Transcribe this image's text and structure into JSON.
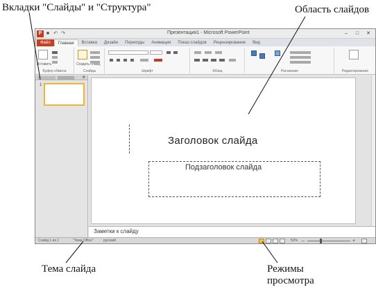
{
  "annotations": {
    "tabs_callout": "Вкладки \"Слайды\" и \"Структура\"",
    "slide_area_callout": "Область слайдов",
    "theme_callout": "Тема слайда",
    "view_modes_callout_line1": "Режимы",
    "view_modes_callout_line2": "просмотра"
  },
  "window": {
    "title": "Презентация1 - Microsoft PowerPoint",
    "app_icon_letter": "P"
  },
  "ribbon": {
    "file_tab": "Файл",
    "tabs": [
      "Главная",
      "Вставка",
      "Дизайн",
      "Переходы",
      "Анимация",
      "Показ слайдов",
      "Рецензирование",
      "Вид"
    ],
    "groups": [
      "Буфер обмена",
      "Слайды",
      "Шрифт",
      "Абзац",
      "Рисование",
      "Редактирование"
    ],
    "paste_label": "Вставить",
    "new_slide_label": "Создать слайд"
  },
  "slides_pane": {
    "slide_number": "1"
  },
  "slide": {
    "title": "Заголовок слайда",
    "subtitle": "Подзаголовок слайда"
  },
  "notes": {
    "text": "Заметки к слайду"
  },
  "statusbar": {
    "slide_counter": "Слайд 1 из 1",
    "theme": "\"Тема Office\"",
    "language": "русский",
    "zoom": "52%"
  },
  "icons": [
    "close-icon",
    "minimize-icon",
    "maximize-icon",
    "save-icon",
    "undo-icon",
    "redo-icon",
    "normal-view-icon",
    "slide-sorter-icon",
    "reading-view-icon",
    "slideshow-icon",
    "zoom-in-icon",
    "zoom-out-icon",
    "fit-to-window-icon"
  ],
  "colors": {
    "file_tab": "#c4401f",
    "thumbnail_border": "#f2b232",
    "active_view": "#f3c24a"
  }
}
